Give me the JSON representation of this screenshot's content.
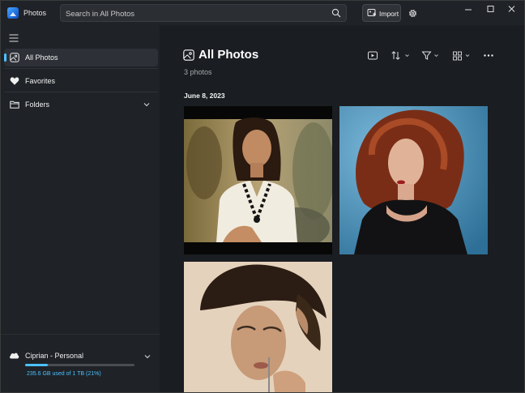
{
  "app": {
    "title": "Photos"
  },
  "search": {
    "placeholder": "Search in All Photos"
  },
  "toolbar": {
    "import_label": "Import"
  },
  "sidebar": {
    "items": [
      {
        "label": "All Photos",
        "icon": "gallery-icon",
        "active": true
      },
      {
        "label": "Favorites",
        "icon": "heart-icon"
      },
      {
        "label": "Folders",
        "icon": "folder-icon",
        "expandable": true
      }
    ],
    "account": {
      "name": "Ciprian - Personal",
      "storage_text": "235.6 GB used of 1 TB (21%)",
      "storage_fraction": 0.21
    }
  },
  "main": {
    "title": "All Photos",
    "count": "3 photos",
    "groups": [
      {
        "date": "June 8, 2023",
        "photos": [
          {
            "name": "photo-woman-white-blouse"
          },
          {
            "name": "photo-woman-red-hair"
          },
          {
            "name": "photo-woman-sepia-portrait"
          }
        ]
      }
    ]
  },
  "colors": {
    "accent": "#4cc2ff",
    "background": "#1a1d22",
    "sidebar": "#1f2227"
  }
}
